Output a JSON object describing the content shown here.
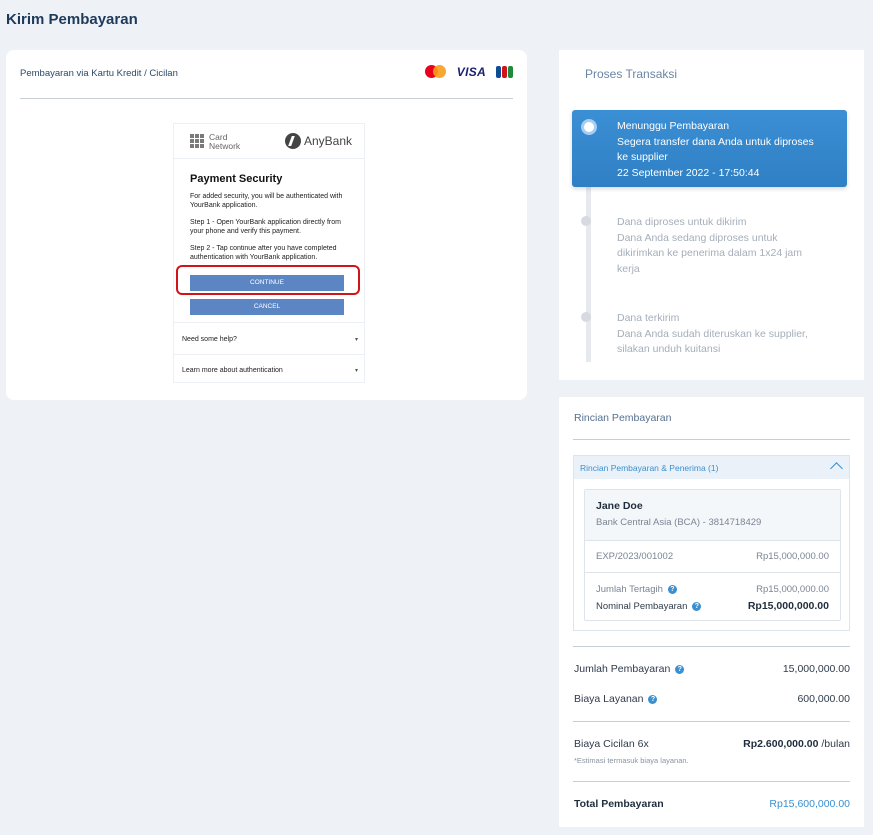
{
  "page_title": "Kirim Pembayaran",
  "payment_method": {
    "header": "Pembayaran via Kartu Kredit / Cicilan",
    "card_logos": [
      "mastercard-logo",
      "visa-logo",
      "jcb-logo"
    ],
    "visa_text": "VISA"
  },
  "auth_frame": {
    "card_network_label": "Card Network",
    "bank_name": "AnyBank",
    "title": "Payment Security",
    "text1": "For added security, you will be authenticated with YourBank application.",
    "text2": "Step 1 - Open YourBank application directly from your phone and verify this payment.",
    "text3": "Step 2 - Tap continue after you have completed authentication with YourBank application.",
    "continue_label": "CONTINUE",
    "cancel_label": "CANCEL",
    "help_label": "Need some help?",
    "learn_label": "Learn more about authentication"
  },
  "process": {
    "title": "Proses Transaksi",
    "steps": [
      {
        "title": "Menunggu Pembayaran",
        "desc_line1": "Segera transfer dana Anda untuk diproses",
        "desc_line2": "ke supplier",
        "time": "22 September 2022 - 17:50:44"
      },
      {
        "title": "Dana diproses untuk dikirim",
        "desc_line1": "Dana Anda sedang diproses untuk",
        "desc_line2": "dikirimkan ke penerima dalam 1x24 jam",
        "desc_line3": "kerja"
      },
      {
        "title": "Dana terkirim",
        "desc_line1": "Dana Anda sudah diteruskan ke supplier,",
        "desc_line2": "silakan unduh kuitansi"
      }
    ]
  },
  "payment": {
    "title": "Rincian Pembayaran",
    "accordion_label": "Rincian Pembayaran & Penerima (1)",
    "payee_name": "Jane Doe",
    "payee_bank": "Bank Central Asia (BCA) - 3814718429",
    "invoice_no": "EXP/2023/001002",
    "invoice_amount": "Rp15,000,000.00",
    "billed_label": "Jumlah Tertagih",
    "billed_amount": "Rp15,000,000.00",
    "nominal_label": "Nominal Pembayaran",
    "nominal_amount": "Rp15,000,000.00",
    "total_payment_label": "Jumlah Pembayaran",
    "total_payment_value": "15,000,000.00",
    "service_fee_label": "Biaya Layanan",
    "service_fee_value": "600,000.00",
    "installment_label": "Biaya Cicilan 6x",
    "installment_value": "Rp2.600,000.00",
    "installment_unit": "/bulan",
    "installment_note": "*Estimasi termasuk biaya layanan.",
    "grand_total_label": "Total Pembayaran",
    "grand_total_value": "Rp15,600,000.00",
    "help_glyph": "?"
  },
  "colors": {
    "accent": "#3a8fd0",
    "button": "#5b86c3",
    "highlight": "#d0141a"
  }
}
